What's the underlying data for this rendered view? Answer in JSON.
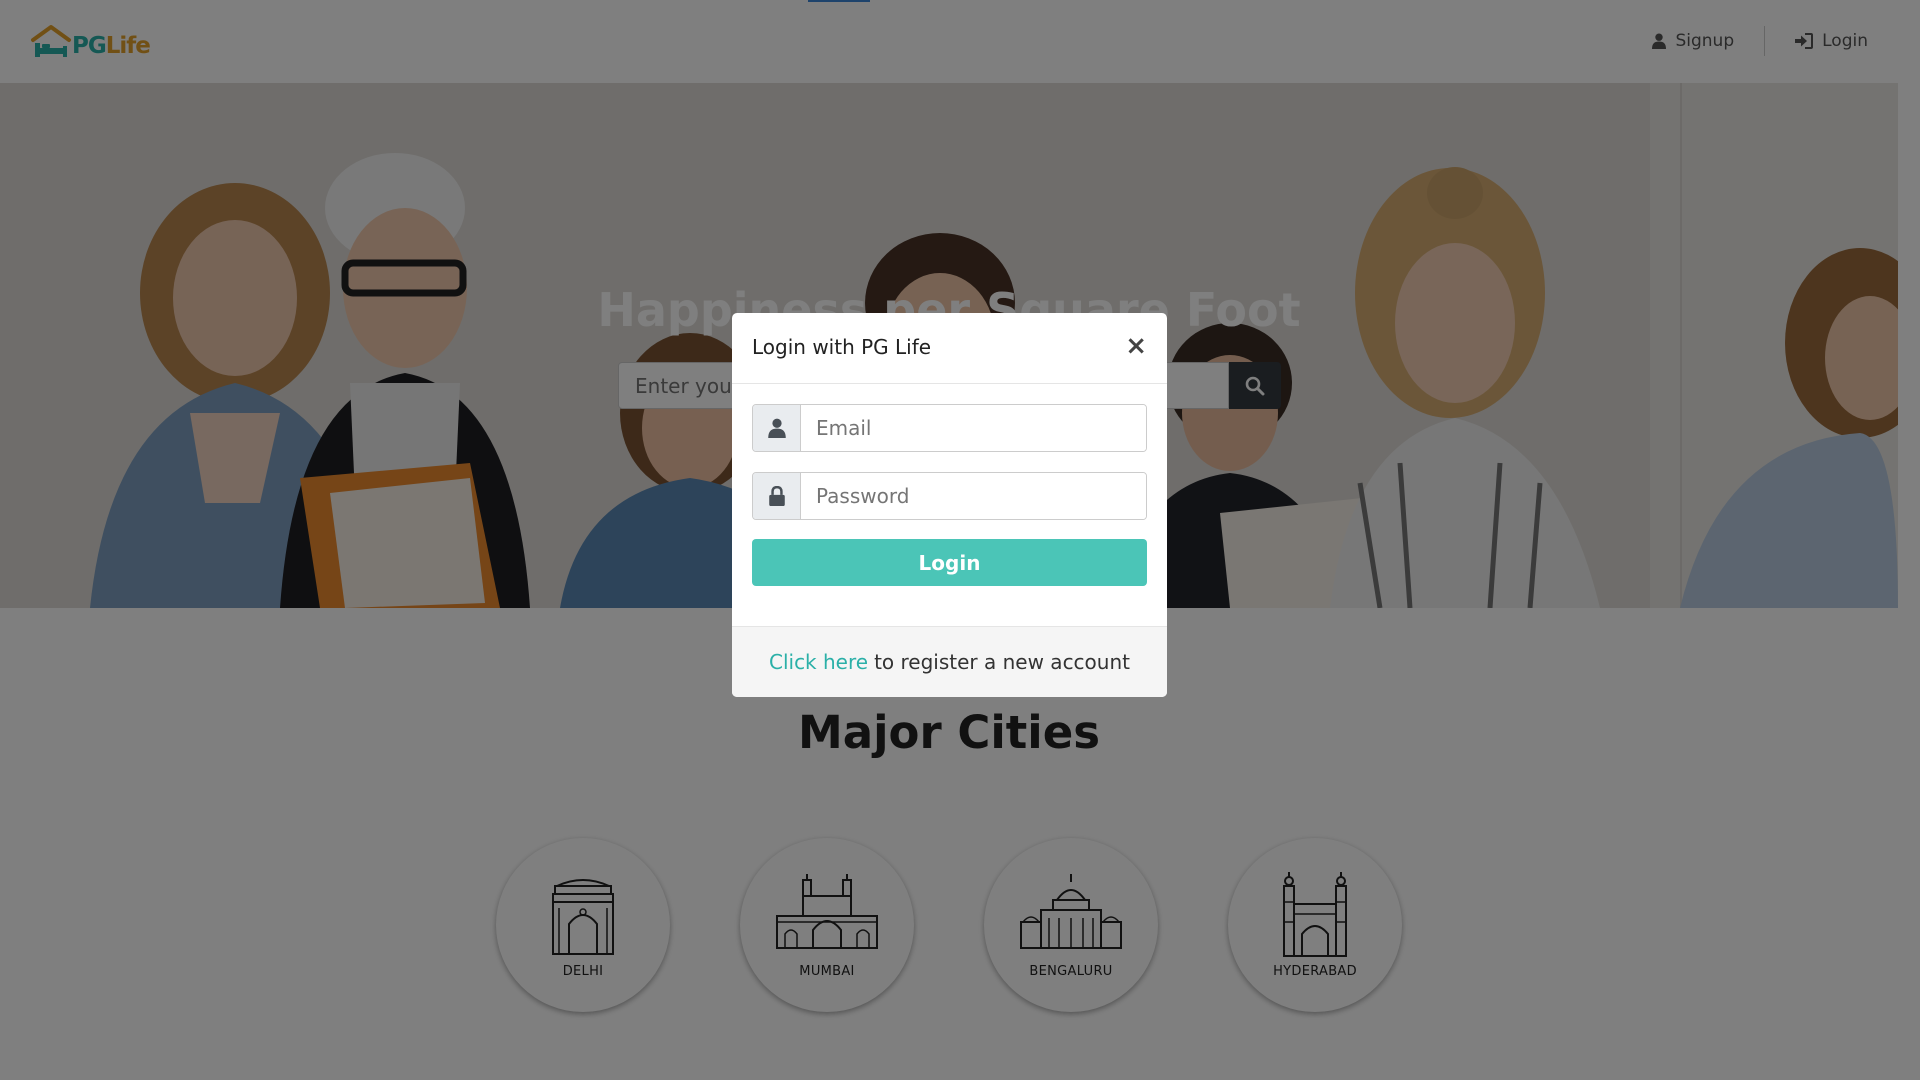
{
  "navbar": {
    "logo_pg": "PG",
    "logo_life": "Life",
    "signup_label": "Signup",
    "login_label": "Login"
  },
  "hero": {
    "title": "Happiness per Square Foot",
    "search_placeholder": "Enter your city to search for PGs"
  },
  "cities": {
    "title": "Major Cities",
    "items": [
      {
        "label": "DELHI",
        "icon": "india-gate-icon"
      },
      {
        "label": "MUMBAI",
        "icon": "gateway-of-india-icon"
      },
      {
        "label": "BENGALURU",
        "icon": "vidhana-soudha-icon"
      },
      {
        "label": "HYDERABAD",
        "icon": "charminar-icon"
      }
    ]
  },
  "modal": {
    "title": "Login with PG Life",
    "close_symbol": "×",
    "email_placeholder": "Email",
    "password_placeholder": "Password",
    "login_button": "Login",
    "footer_link": "Click here",
    "footer_text": "to register a new account"
  },
  "colors": {
    "accent": "#4bc5b7",
    "logo_teal": "#2bb0a8",
    "logo_orange": "#e3a02a",
    "search_button": "#343a40"
  }
}
